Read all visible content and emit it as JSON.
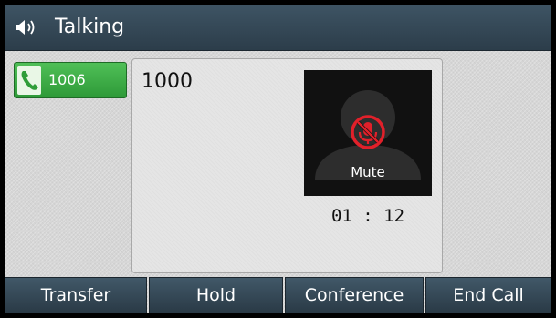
{
  "header": {
    "title": "Talking",
    "icon": "speaker-icon"
  },
  "line_key": {
    "number": "1006",
    "icon": "phone-handset-icon",
    "color": "#3aaa44"
  },
  "call": {
    "callee": "1000",
    "status": "Mute",
    "status_icon": "microphone-muted-icon",
    "duration": "01 : 12"
  },
  "softkeys": [
    {
      "label": "Transfer"
    },
    {
      "label": "Hold"
    },
    {
      "label": "Conference"
    },
    {
      "label": "End Call"
    }
  ],
  "colors": {
    "mute_red": "#e1202a",
    "line_green": "#3aaa44",
    "bar_dark": "#34495a"
  }
}
